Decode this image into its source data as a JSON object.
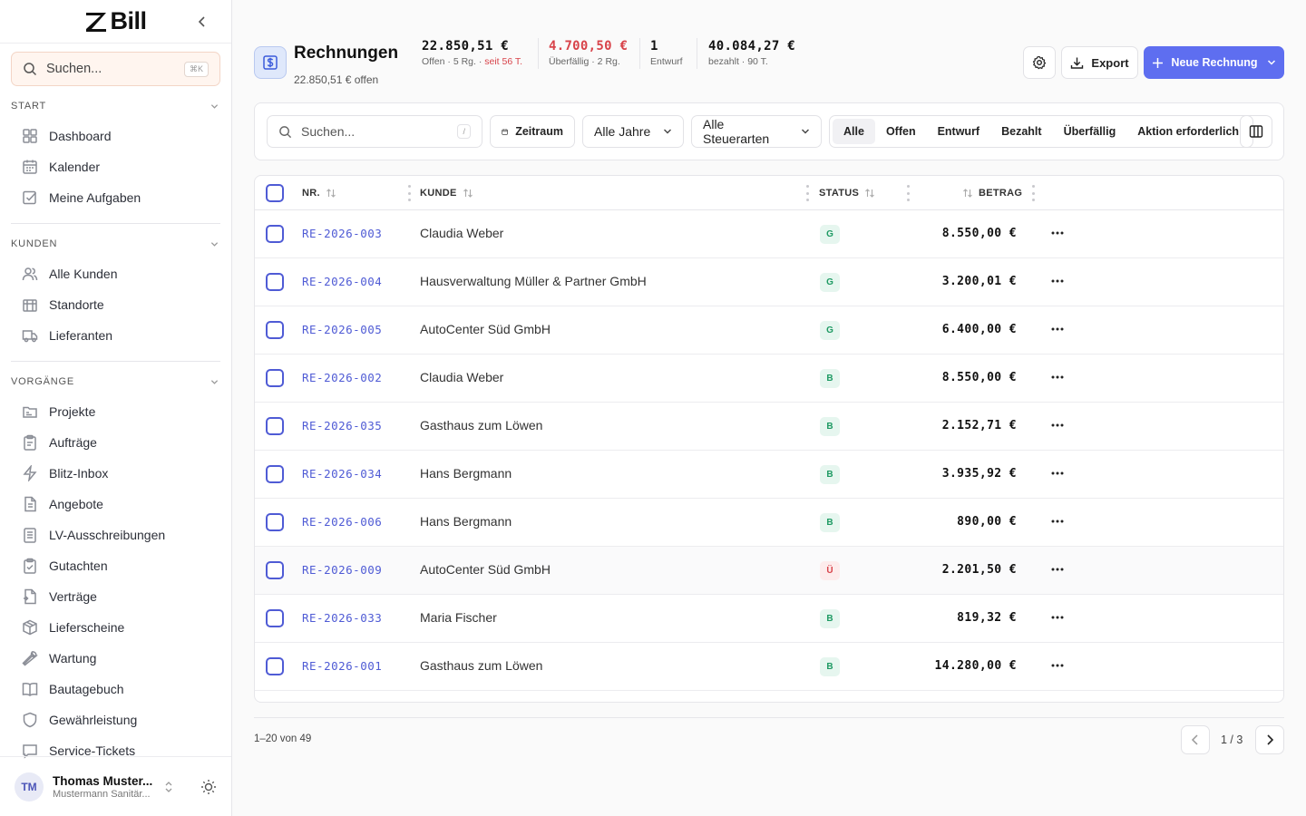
{
  "sidebar": {
    "brand": "Bill",
    "search": {
      "placeholder": "Suchen...",
      "shortcut": "⌘K"
    },
    "sections": [
      {
        "title": "START",
        "items": [
          {
            "label": "Dashboard",
            "icon": "dashboard-icon"
          },
          {
            "label": "Kalender",
            "icon": "calendar-icon"
          },
          {
            "label": "Meine Aufgaben",
            "icon": "checkbox-icon"
          }
        ]
      },
      {
        "title": "KUNDEN",
        "items": [
          {
            "label": "Alle Kunden",
            "icon": "users-icon"
          },
          {
            "label": "Standorte",
            "icon": "building-icon"
          },
          {
            "label": "Lieferanten",
            "icon": "truck-icon"
          }
        ]
      },
      {
        "title": "VORGÄNGE",
        "items": [
          {
            "label": "Projekte",
            "icon": "folder-icon"
          },
          {
            "label": "Aufträge",
            "icon": "clipboard-icon"
          },
          {
            "label": "Blitz-Inbox",
            "icon": "bolt-icon"
          },
          {
            "label": "Angebote",
            "icon": "document-icon"
          },
          {
            "label": "LV-Ausschreibungen",
            "icon": "list-icon"
          },
          {
            "label": "Gutachten",
            "icon": "clipboard-check-icon"
          },
          {
            "label": "Verträge",
            "icon": "contract-icon"
          },
          {
            "label": "Lieferscheine",
            "icon": "package-icon"
          },
          {
            "label": "Wartung",
            "icon": "wrench-icon"
          },
          {
            "label": "Bautagebuch",
            "icon": "book-icon"
          },
          {
            "label": "Gewährleistung",
            "icon": "shield-icon"
          },
          {
            "label": "Service-Tickets",
            "icon": "message-icon"
          }
        ]
      }
    ],
    "user": {
      "initials": "TM",
      "name": "Thomas Muster...",
      "org": "Mustermann Sanitär..."
    }
  },
  "header": {
    "title": "Rechnungen",
    "subtitle": "22.850,51 € offen",
    "stats": [
      {
        "value": "22.850,51 €",
        "label": "Offen · 5 Rg. · ",
        "label_extra": "seit 56 T."
      },
      {
        "value": "4.700,50 €",
        "label": "Überfällig · 2 Rg."
      },
      {
        "value": "1",
        "label": "Entwurf"
      },
      {
        "value": "40.084,27 €",
        "label": "bezahlt · 90 T."
      }
    ],
    "export_label": "Export",
    "new_label": "Neue Rechnung"
  },
  "toolbar": {
    "search_placeholder": "Suchen...",
    "search_shortcut": "/",
    "zeitraum": "Zeitraum",
    "jahre": "Alle Jahre",
    "steuerarten": "Alle Steuerarten",
    "filters": [
      "Alle",
      "Offen",
      "Entwurf",
      "Bezahlt",
      "Überfällig",
      "Aktion erforderlich"
    ],
    "active_filter": "Alle"
  },
  "table": {
    "columns": {
      "nr": "NR.",
      "kunde": "KUNDE",
      "status": "STATUS",
      "betrag": "BETRAG"
    },
    "rows": [
      {
        "nr": "RE-2026-003",
        "kunde": "Claudia Weber",
        "status": "G",
        "betrag": "8.550,00 €"
      },
      {
        "nr": "RE-2026-004",
        "kunde": "Hausverwaltung Müller & Partner GmbH",
        "status": "G",
        "betrag": "3.200,01 €"
      },
      {
        "nr": "RE-2026-005",
        "kunde": "AutoCenter Süd GmbH",
        "status": "G",
        "betrag": "6.400,00 €"
      },
      {
        "nr": "RE-2026-002",
        "kunde": "Claudia Weber",
        "status": "B",
        "betrag": "8.550,00 €"
      },
      {
        "nr": "RE-2026-035",
        "kunde": "Gasthaus zum Löwen",
        "status": "B",
        "betrag": "2.152,71 €"
      },
      {
        "nr": "RE-2026-034",
        "kunde": "Hans Bergmann",
        "status": "B",
        "betrag": "3.935,92 €"
      },
      {
        "nr": "RE-2026-006",
        "kunde": "Hans Bergmann",
        "status": "B",
        "betrag": "890,00 €"
      },
      {
        "nr": "RE-2026-009",
        "kunde": "AutoCenter Süd GmbH",
        "status": "Ü",
        "betrag": "2.201,50 €"
      },
      {
        "nr": "RE-2026-033",
        "kunde": "Maria Fischer",
        "status": "B",
        "betrag": "819,32 €"
      },
      {
        "nr": "RE-2026-001",
        "kunde": "Gasthaus zum Löwen",
        "status": "B",
        "betrag": "14.280,00 €"
      }
    ]
  },
  "footer": {
    "count": "1–20 von 49",
    "page": "1 / 3"
  },
  "colors": {
    "accent": "#5e6ef0",
    "link": "#4f5bd5",
    "overdue": "#d8434a",
    "status_green": "#e6f6ef",
    "status_red": "#fdecec"
  }
}
